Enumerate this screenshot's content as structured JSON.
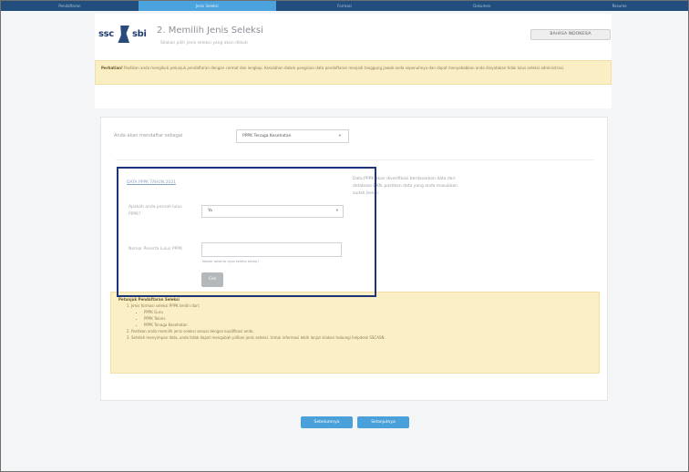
{
  "steps": [
    {
      "label": "Pendaftaran",
      "active": false
    },
    {
      "label": "Jenis Seleksi",
      "active": true
    },
    {
      "label": "Formasi",
      "active": false
    },
    {
      "label": "Dokumen",
      "active": false
    },
    {
      "label": "Resume",
      "active": false
    }
  ],
  "header": {
    "logo_left": "ssc",
    "logo_right": "sbi",
    "title": "2. Memilih Jenis Seleksi",
    "subtitle": "Silakan pilih jenis seleksi yang akan diikuti",
    "language_button": "BAHASA INDONESIA"
  },
  "notice": {
    "label": "Perhatian!",
    "text": "Pastikan anda mengikuti petunjuk pendaftaran dengan cermat dan lengkap. Kesalahan dalam pengisian data pendaftaran menjadi tanggung jawab anda sepenuhnya dan dapat menyebabkan anda dinyatakan tidak lulus seleksi administrasi."
  },
  "content": {
    "regas_label": "Anda akan mendaftar sebagai",
    "regas_value": "PPPK Tenaga Kesehatan",
    "data_title": "DATA PPPK TAHUN 2021",
    "field1_label": "Apakah anda pernah lulus PPPK?",
    "field1_value": "Ya",
    "field2_label": "Nomor Peserta Lulus PPPK",
    "field2_value": "",
    "field2_hint": "Nomor peserta ujian seleksi tahap I",
    "cek_label": "Cek",
    "info_text": "Data PPPK akan diverifikasi berdasarkan data dari database BKN, pastikan data yang anda masukkan sudah benar."
  },
  "hint": {
    "title": "Petunjuk Pendaftaran Seleksi",
    "items": [
      "Jenis formasi seleksi PPPK terdiri dari:",
      "Pastikan anda memilih jenis seleksi sesuai dengan kualifikasi anda.",
      "Setelah menyimpan data, anda tidak dapat mengubah pilihan jenis seleksi. Untuk informasi lebih lanjut silakan hubungi helpdesk SSCASN."
    ],
    "subitems": [
      "PPPK Guru",
      "PPPK Teknis",
      "PPPK Tenaga Kesehatan"
    ]
  },
  "buttons": {
    "back": "Sebelumnya",
    "next": "Selanjutnya"
  },
  "colors": {
    "step_bar": "#214e7c",
    "step_active": "#4aa3dc",
    "notice_bg": "#faeec4",
    "primary_button": "#4aa0d8",
    "focus_box": "#1d3478"
  }
}
